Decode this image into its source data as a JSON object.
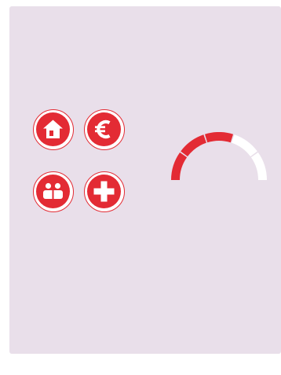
{
  "colors": {
    "card_background": "#e9dfea",
    "accent": "#e32b34",
    "gauge_empty": "#ffffff"
  },
  "icons": [
    {
      "name": "home-icon",
      "meaning": "home"
    },
    {
      "name": "euro-icon",
      "meaning": "euro"
    },
    {
      "name": "people-icon",
      "meaning": "people"
    },
    {
      "name": "medical-cross-icon",
      "meaning": "health"
    }
  ],
  "gauge": {
    "segments_total": 5,
    "segments_filled": 3
  }
}
